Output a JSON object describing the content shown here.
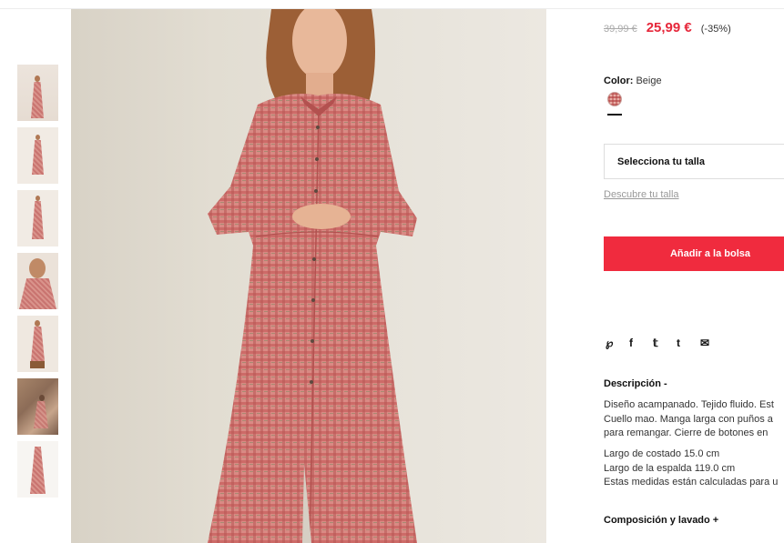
{
  "product": {
    "price_old": "39,99 €",
    "price_new": "25,99 €",
    "discount": "(-35%)",
    "color_label": "Color:",
    "color_value": "Beige"
  },
  "size": {
    "select_label": "Selecciona tu talla",
    "guide_link": "Descubre tu talla"
  },
  "cart": {
    "add_label": "Añadir a la bolsa"
  },
  "share": {
    "icons": [
      "pinterest-icon",
      "facebook-icon",
      "twitter-icon",
      "tumblr-icon",
      "email-icon"
    ],
    "glyphs": [
      "℘",
      "f",
      "𝕥",
      "t",
      "✉"
    ]
  },
  "description": {
    "title": "Descripción -",
    "lines_a": [
      "Diseño acampanado. Tejido fluido. Est",
      "Cuello mao. Manga larga con puños a",
      "para remangar. Cierre de botones en"
    ],
    "lines_b": [
      "Largo de costado 15.0 cm",
      "Largo de la espalda 119.0 cm",
      "Estas medidas están calculadas para u"
    ]
  },
  "composition": {
    "title": "Composición y lavado +"
  },
  "colors": {
    "sale_red": "#e6273a",
    "button_red": "#f02b3e",
    "dress_check": "#c9706b"
  }
}
